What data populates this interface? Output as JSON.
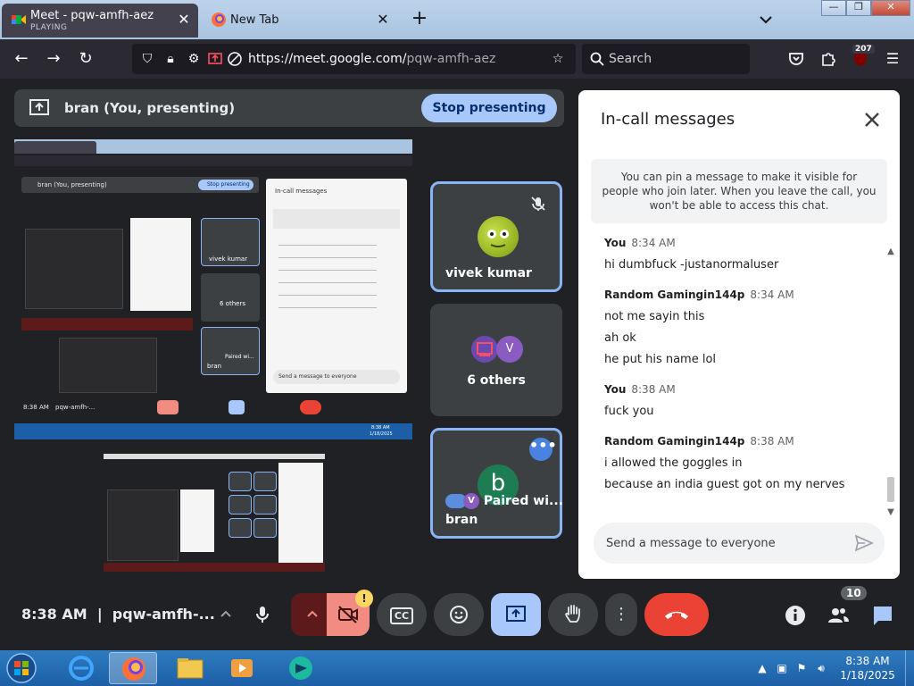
{
  "browser": {
    "tabs": [
      {
        "title": "Meet - pqw-amfh-aez",
        "subtitle": "PLAYING",
        "active": true
      },
      {
        "title": "New Tab",
        "active": false
      }
    ],
    "url_host": "https://meet.google.com/",
    "url_path": "pqw-amfh-aez",
    "search_placeholder": "Search",
    "extension_badge": "207",
    "window_controls": {
      "minimize": "—",
      "maximize": "❐",
      "close": "✕"
    }
  },
  "presenting": {
    "banner_label": "bran (You, presenting)",
    "stop_label": "Stop presenting"
  },
  "shared_screen": {
    "banner_label": "bran (You, presenting)",
    "stop_label": "Stop presenting",
    "chat_title": "In-call messages",
    "chat_placeholder": "Send a message to everyone",
    "tile1": "vivek kumar",
    "tile2": "6 others",
    "tile3_name": "bran",
    "tile3_paired": "Paired wi...",
    "clock": "8:38 AM",
    "meeting": "pqw-amfh-...",
    "taskbar_time": "8:38 AM",
    "taskbar_date": "1/18/2025"
  },
  "participants": [
    {
      "name": "vivek kumar",
      "muted": true
    },
    {
      "name": "6 others",
      "avatar_letter": "V"
    },
    {
      "name": "bran",
      "avatar_letter": "b",
      "paired_label": "Paired wi...",
      "paired_letter": "V"
    }
  ],
  "chat": {
    "title": "In-call messages",
    "pin_note": "You can pin a message to make it visible for people who join later. When you leave the call, you won't be able to access this chat.",
    "input_placeholder": "Send a message to everyone",
    "messages": [
      {
        "sender": "You",
        "time": "8:34 AM",
        "lines": [
          "hi dumbfuck -justanormaluser"
        ]
      },
      {
        "sender": "Random Gamingin144p",
        "time": "8:34 AM",
        "lines": [
          "not me sayin this",
          "ah ok",
          "he put his name lol"
        ]
      },
      {
        "sender": "You",
        "time": "8:38 AM",
        "lines": [
          "fuck you"
        ]
      },
      {
        "sender": "Random Gamingin144p",
        "time": "8:38 AM",
        "lines": [
          "i allowed the goggles in",
          "because an india guest got on my nerves"
        ]
      }
    ]
  },
  "controls": {
    "clock": "8:38 AM",
    "separator": "|",
    "meeting_code": "pqw-amfh-...",
    "participant_count": "10",
    "warning_mark": "!",
    "cc_label": "CC"
  },
  "taskbar": {
    "time": "8:38 AM",
    "date": "1/18/2025"
  },
  "colors": {
    "accent_blue": "#a8c7fa",
    "end_call_red": "#ea4335",
    "tile_border": "#8ab4f8",
    "meet_bg": "#202124"
  }
}
